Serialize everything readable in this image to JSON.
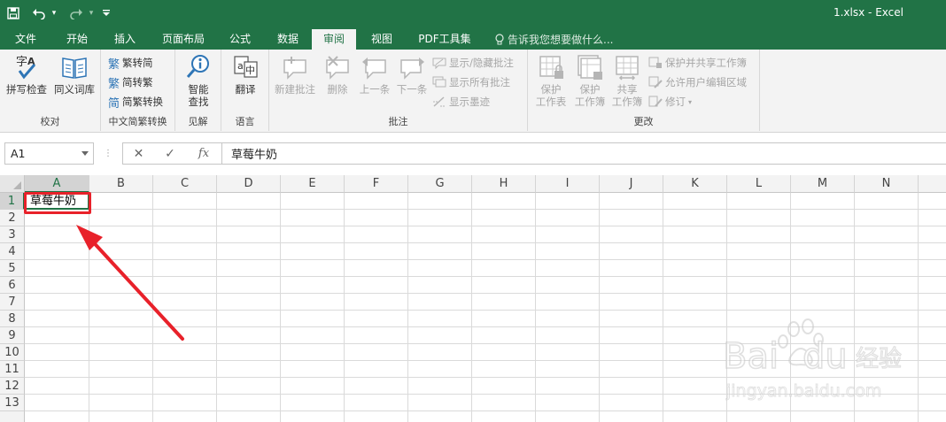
{
  "titlebar": {
    "filename": "1.xlsx",
    "separator": " - ",
    "app": "Excel",
    "bg_color": "#217346"
  },
  "tabs": [
    {
      "label": "文件",
      "active": false
    },
    {
      "label": "开始",
      "active": false
    },
    {
      "label": "插入",
      "active": false
    },
    {
      "label": "页面布局",
      "active": false
    },
    {
      "label": "公式",
      "active": false
    },
    {
      "label": "数据",
      "active": false
    },
    {
      "label": "审阅",
      "active": true
    },
    {
      "label": "视图",
      "active": false
    },
    {
      "label": "PDF工具集",
      "active": false
    }
  ],
  "tellme": "告诉我您想要做什么...",
  "ribbon": {
    "proofing": {
      "label": "校对",
      "spell": "拼写检查",
      "thesaurus": "同义词库"
    },
    "chinese": {
      "label": "中文简繁转换",
      "to_simplified": "繁转简",
      "to_traditional": "简转繁",
      "convert": "简繁转换"
    },
    "insights": {
      "label": "见解",
      "smart_lookup_1": "智能",
      "smart_lookup_2": "查找"
    },
    "language": {
      "label": "语言",
      "translate": "翻译"
    },
    "comments": {
      "label": "批注",
      "new": "新建批注",
      "delete": "删除",
      "prev": "上一条",
      "next": "下一条",
      "show_hide": "显示/隐藏批注",
      "show_all": "显示所有批注",
      "show_ink": "显示墨迹"
    },
    "changes": {
      "label": "更改",
      "protect_sheet_1": "保护",
      "protect_sheet_2": "工作表",
      "protect_wb_1": "保护",
      "protect_wb_2": "工作簿",
      "share_wb_1": "共享",
      "share_wb_2": "工作簿",
      "protect_share": "保护并共享工作簿",
      "allow_edit": "允许用户编辑区域",
      "track": "修订"
    }
  },
  "formula_bar": {
    "name_box": "A1",
    "cancel": "✕",
    "enter": "✓",
    "fx": "fx",
    "content": "草莓牛奶"
  },
  "grid": {
    "columns": [
      "A",
      "B",
      "C",
      "D",
      "E",
      "F",
      "G",
      "H",
      "I",
      "J",
      "K",
      "L",
      "M",
      "N"
    ],
    "rows": [
      "1",
      "2",
      "3",
      "4",
      "5",
      "6",
      "7",
      "8",
      "9",
      "10",
      "11",
      "12",
      "13"
    ],
    "selected_cell": "A1",
    "a1_value": "草莓牛奶"
  },
  "annotation": {
    "highlight_color": "#e8212a"
  },
  "watermark": {
    "brand": "Baidu经验",
    "url": "jingyan.baidu.com"
  }
}
